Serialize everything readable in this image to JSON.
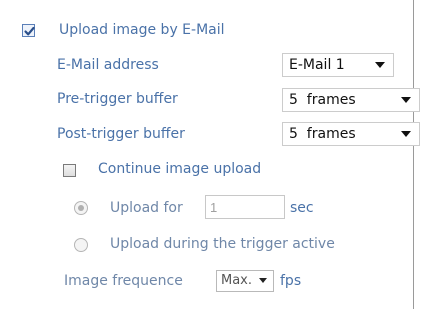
{
  "upload_by_email": {
    "label": "Upload image by E-Mail",
    "checked": true
  },
  "email_address": {
    "label": "E-Mail address",
    "value": "E-Mail 1"
  },
  "pre_trigger": {
    "label": "Pre-trigger buffer",
    "value": "5  frames"
  },
  "post_trigger": {
    "label": "Post-trigger buffer",
    "value": "5  frames"
  },
  "continue_upload": {
    "label": "Continue image upload",
    "checked": false
  },
  "upload_for": {
    "label": "Upload for",
    "value": "1",
    "unit": "sec"
  },
  "upload_during": {
    "label": "Upload during the trigger active"
  },
  "image_frequence": {
    "label": "Image frequence",
    "value": "Max.",
    "unit": "fps"
  },
  "icons": {
    "checkmark": "checkmark-icon",
    "dropdown": "chevron-down-icon",
    "radio": "radio-dot"
  },
  "colors": {
    "label": "#4a72a8",
    "checkmark": "#2b4f8a",
    "divider": "#9a9a9a"
  }
}
